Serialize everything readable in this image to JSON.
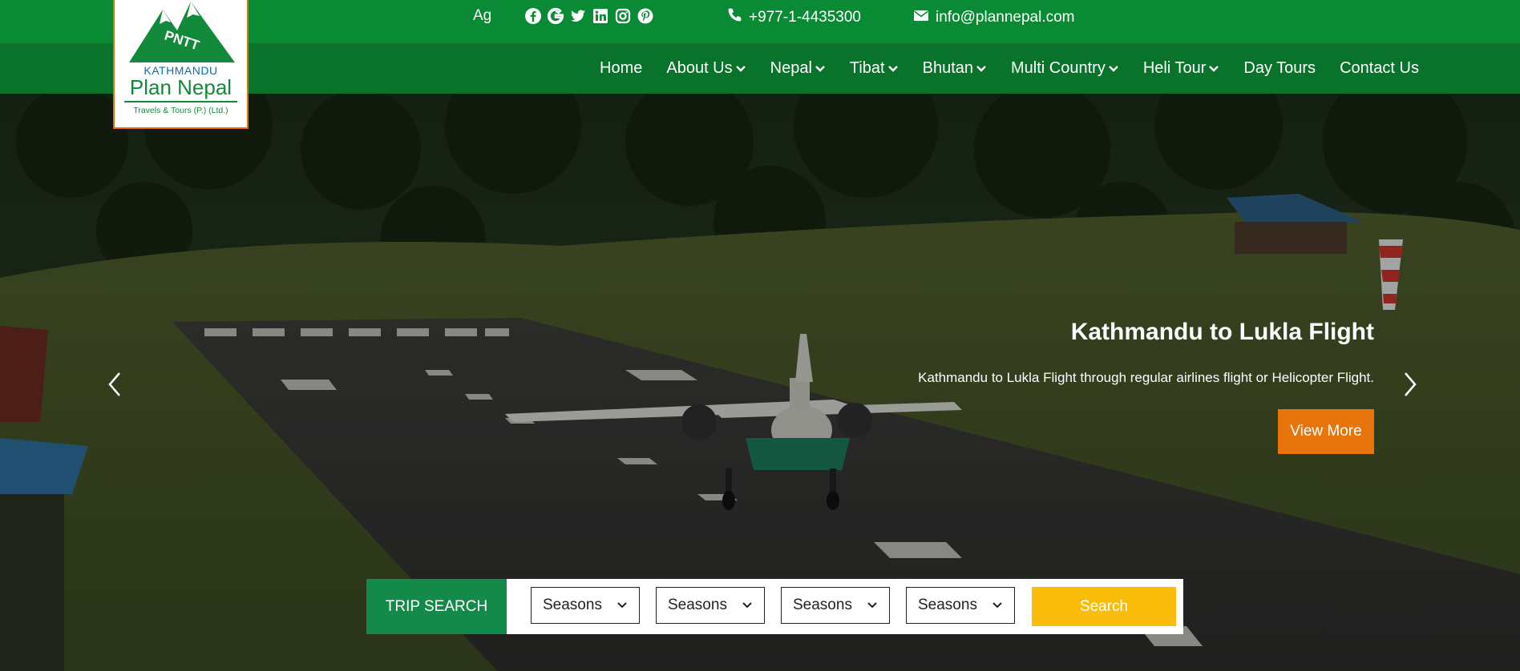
{
  "topbar": {
    "lang": "Ag",
    "social": [
      "facebook-icon",
      "google-icon",
      "twitter-icon",
      "linkedin-icon",
      "instagram-icon",
      "pinterest-icon"
    ],
    "phone": "+977-1-4435300",
    "email": "info@plannepal.com"
  },
  "logo": {
    "badge": "PNTT",
    "city": "KATHMANDU",
    "name": "Plan Nepal",
    "tagline": "Travels & Tours (P.) (Ltd.)"
  },
  "nav": [
    {
      "label": "Home",
      "dropdown": false
    },
    {
      "label": "About Us",
      "dropdown": true
    },
    {
      "label": "Nepal",
      "dropdown": true
    },
    {
      "label": "Tibat",
      "dropdown": true
    },
    {
      "label": "Bhutan",
      "dropdown": true
    },
    {
      "label": "Multi Country",
      "dropdown": true
    },
    {
      "label": "Heli Tour",
      "dropdown": true
    },
    {
      "label": "Day Tours",
      "dropdown": false
    },
    {
      "label": "Contact Us",
      "dropdown": false
    }
  ],
  "hero": {
    "title": "Kathmandu to Lukla Flight",
    "description": "Kathmandu to Lukla Flight through regular airlines flight or Helicopter Flight.",
    "button": "View More"
  },
  "trip_search": {
    "label": "TRIP SEARCH",
    "selects": [
      "Seasons",
      "Seasons",
      "Seasons",
      "Seasons"
    ],
    "button": "Search"
  },
  "colors": {
    "topbar": "#0b8a35",
    "navbar": "#09732c",
    "accent_orange": "#e8740c",
    "search_yellow": "#fbbd0b",
    "search_label": "#138a4a"
  }
}
